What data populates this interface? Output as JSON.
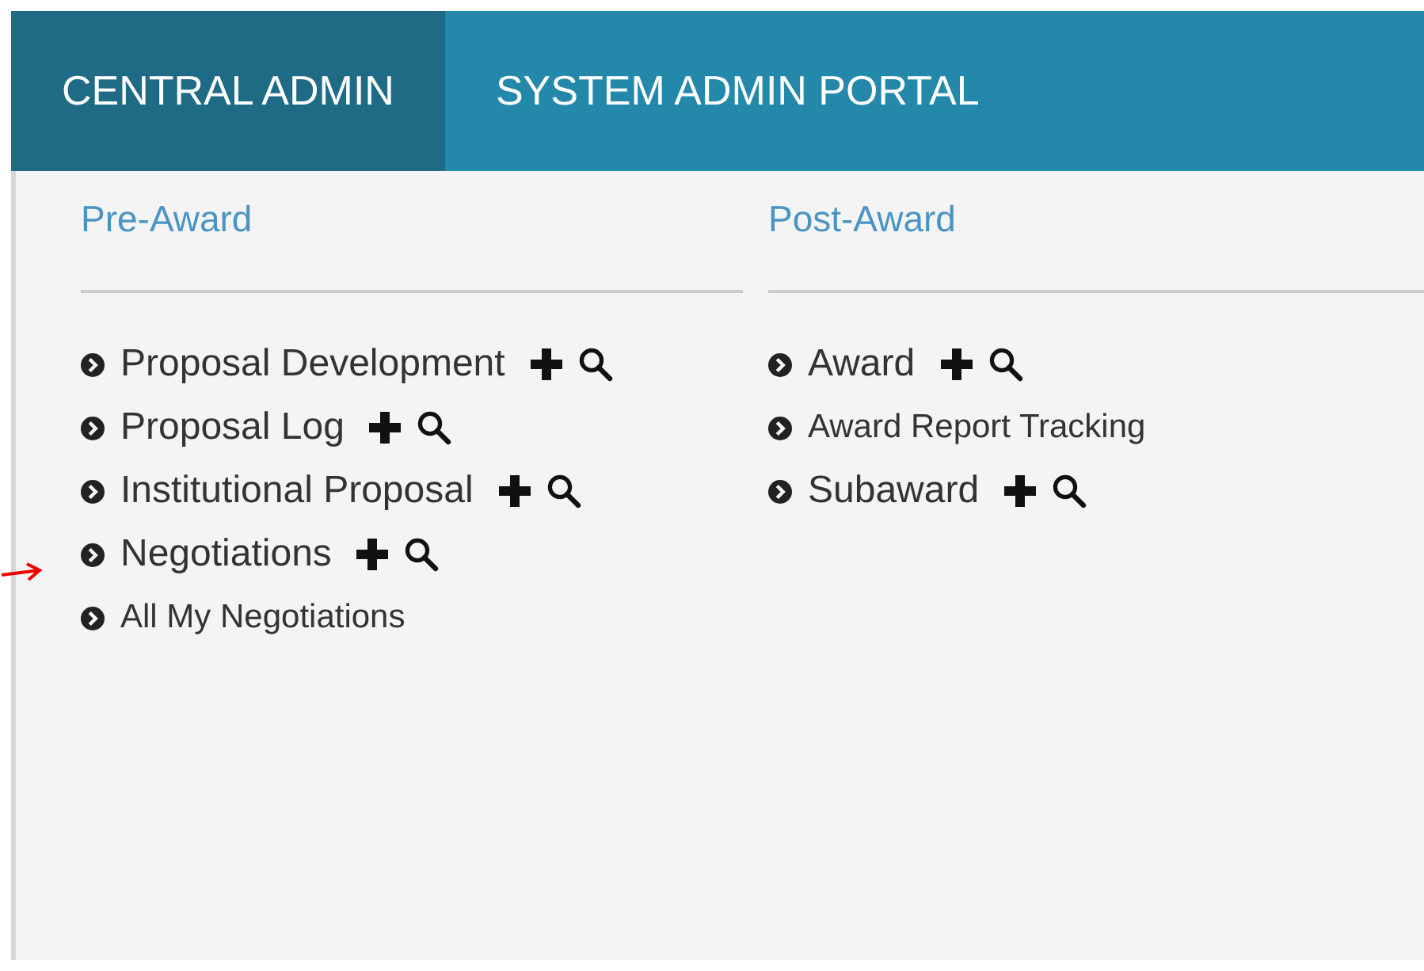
{
  "tabs": [
    {
      "label": "CENTRAL ADMIN",
      "selected": true
    },
    {
      "label": "SYSTEM ADMIN PORTAL",
      "selected": false
    }
  ],
  "columns": [
    {
      "heading": "Pre-Award",
      "items": [
        {
          "label": "Proposal Development",
          "kind": "record"
        },
        {
          "label": "Proposal Log",
          "kind": "record"
        },
        {
          "label": "Institutional Proposal",
          "kind": "record"
        },
        {
          "label": "Negotiations",
          "kind": "record"
        },
        {
          "label": "All My Negotiations",
          "kind": "link"
        }
      ]
    },
    {
      "heading": "Post-Award",
      "items": [
        {
          "label": "Award",
          "kind": "record"
        },
        {
          "label": "Award Report Tracking",
          "kind": "link"
        },
        {
          "label": "Subaward",
          "kind": "record"
        }
      ]
    }
  ]
}
